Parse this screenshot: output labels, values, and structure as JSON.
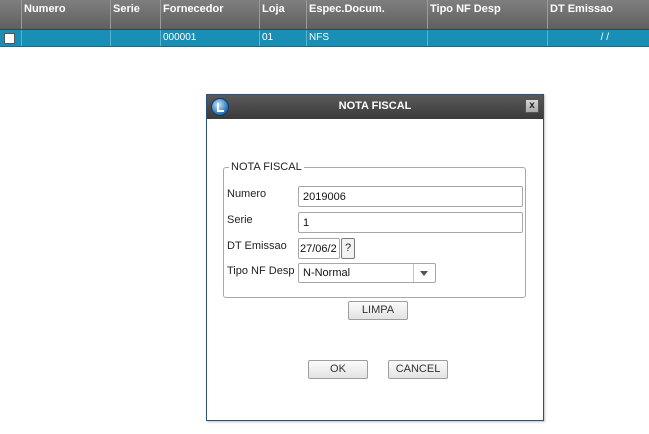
{
  "grid": {
    "columns": [
      "Numero",
      "Serie",
      "Fornecedor",
      "Loja",
      "Espec.Docum.",
      "Tipo NF Desp",
      "DT Emissao"
    ],
    "row": {
      "numero": "",
      "serie": "",
      "fornecedor": "000001",
      "loja": "01",
      "espec": "NFS",
      "tipo_nf": "",
      "dt_emissao": "/ /"
    }
  },
  "dialog": {
    "title": "NOTA FISCAL",
    "close_label": "x",
    "group_title": "NOTA FISCAL",
    "fields": {
      "numero": {
        "label": "Numero",
        "value": "2019006"
      },
      "serie": {
        "label": "Serie",
        "value": "1"
      },
      "dt_emissao": {
        "label": "DT Emissao",
        "value": "27/06/2",
        "button": "?"
      },
      "tipo_nf": {
        "label": "Tipo NF Desp",
        "value": "N-Normal"
      }
    },
    "buttons": {
      "limpa": "LIMPA",
      "ok": "OK",
      "cancel": "CANCEL"
    }
  },
  "colors": {
    "header_bg": "#6f6f6f",
    "row_selected": "#1a8fb6",
    "title_bar": "#4a4a4a",
    "dialog_border": "#2c4f7c"
  }
}
